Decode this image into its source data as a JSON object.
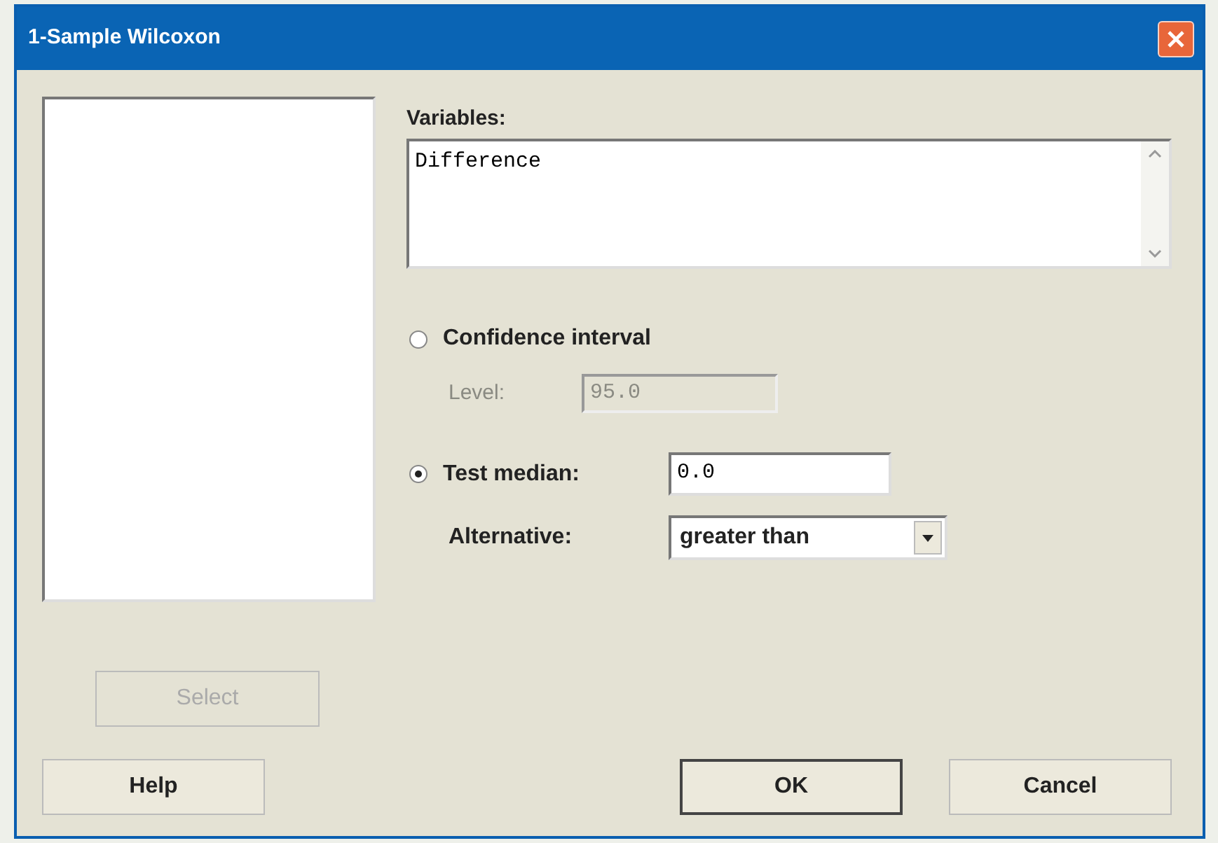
{
  "window": {
    "title": "1-Sample Wilcoxon"
  },
  "variables": {
    "label": "Variables:",
    "value": "Difference"
  },
  "confidence_interval": {
    "label": "Confidence interval",
    "selected": false,
    "level": {
      "label": "Level:",
      "value": "95.0",
      "disabled": true
    }
  },
  "test_median": {
    "label": "Test median:",
    "selected": true,
    "value": "0.0",
    "alternative": {
      "label": "Alternative:",
      "value": "greater than"
    }
  },
  "select_button": {
    "label": "Select",
    "disabled": true
  },
  "buttons": [
    {
      "label": "Help",
      "default": false
    },
    {
      "label": "OK",
      "default": true
    },
    {
      "label": "Cancel",
      "default": false
    }
  ]
}
